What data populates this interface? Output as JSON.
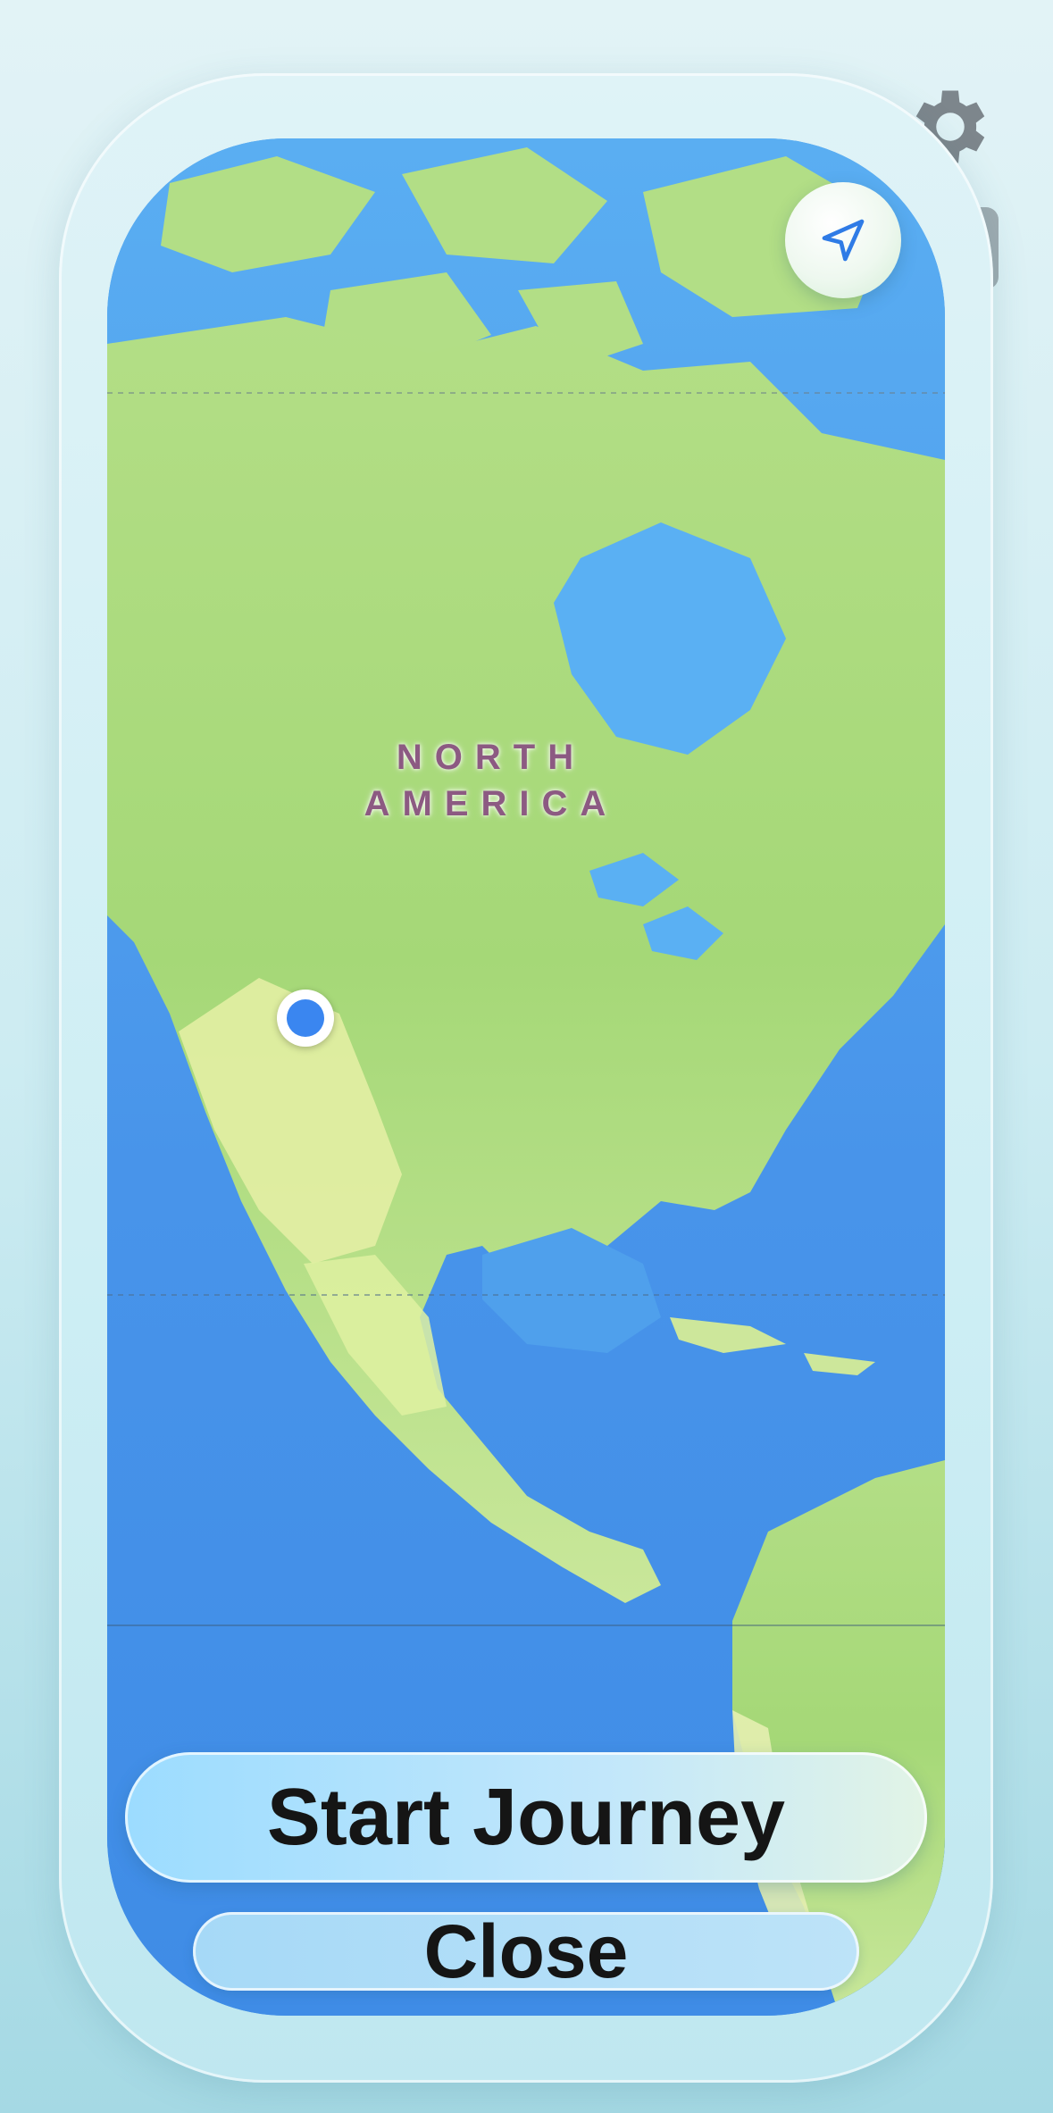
{
  "map": {
    "continent_label_line1": "NORTH",
    "continent_label_line2": "AMERICA",
    "location_pin_icon": "current-location-dot",
    "locate_icon": "location-arrow-icon"
  },
  "toolbar": {
    "settings_icon": "gear-icon"
  },
  "actions": {
    "start_label": "Start Journey",
    "close_label": "Close"
  },
  "colors": {
    "ocean": "#4a9cec",
    "land": "#a9db7a",
    "pin": "#3a86f0",
    "accent_button": "#9cdcff"
  }
}
